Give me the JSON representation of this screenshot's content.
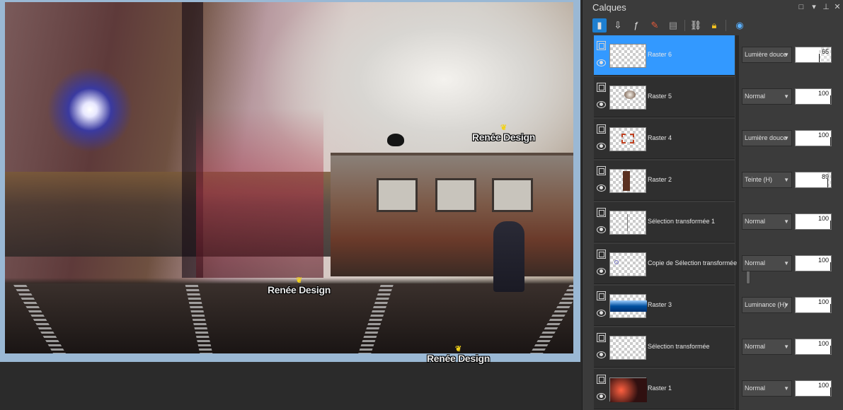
{
  "panel": {
    "title": "Calques",
    "window_buttons": [
      "□",
      "▾",
      "⊥",
      "✕"
    ]
  },
  "toolbar": {
    "icons": [
      "new-raster-layer-icon",
      "new-vector-layer-icon",
      "new-adjustment-layer-icon",
      "new-mask-layer-icon",
      "delete-layer-icon",
      "link-icon",
      "lock-icon",
      "edit-selection-icon"
    ]
  },
  "watermarks": {
    "text": "Renée Design",
    "wing": "❦"
  },
  "layers": [
    {
      "name": "Raster 6",
      "blend": "Lumière douce",
      "opacity": "65",
      "opacity_pct": 65,
      "selected": true
    },
    {
      "name": "Raster 5",
      "blend": "Normal",
      "opacity": "100",
      "opacity_pct": 100,
      "selected": false
    },
    {
      "name": "Raster 4",
      "blend": "Lumière douce",
      "opacity": "100",
      "opacity_pct": 100,
      "selected": false
    },
    {
      "name": "Raster 2",
      "blend": "Teinte (H)",
      "opacity": "89",
      "opacity_pct": 89,
      "selected": false
    },
    {
      "name": "Sélection transformée 1",
      "blend": "Normal",
      "opacity": "100",
      "opacity_pct": 100,
      "selected": false
    },
    {
      "name": "Copie de Sélection transformée",
      "blend": "Normal",
      "opacity": "100",
      "opacity_pct": 100,
      "selected": false
    },
    {
      "name": "Raster 3",
      "blend": "Luminance (H)",
      "opacity": "100",
      "opacity_pct": 100,
      "selected": false
    },
    {
      "name": "Sélection transformée",
      "blend": "Normal",
      "opacity": "100",
      "opacity_pct": 100,
      "selected": false
    },
    {
      "name": "Raster 1",
      "blend": "Normal",
      "opacity": "100",
      "opacity_pct": 100,
      "selected": false
    }
  ],
  "colors": {
    "selected_row": "#3399ff",
    "panel_bg": "#3b3b3b"
  }
}
